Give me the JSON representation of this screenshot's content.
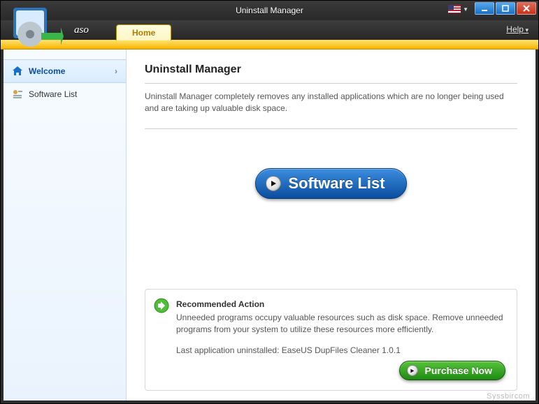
{
  "window": {
    "title": "Uninstall Manager"
  },
  "header": {
    "brand": "aso",
    "home_tab": "Home",
    "help_label": "Help"
  },
  "sidebar": {
    "items": [
      {
        "label": "Welcome"
      },
      {
        "label": "Software List"
      }
    ]
  },
  "main": {
    "title": "Uninstall Manager",
    "description": "Uninstall Manager completely removes any installed applications which are no longer being used and are taking up valuable disk space.",
    "big_button_label": "Software List"
  },
  "recommended": {
    "title": "Recommended Action",
    "description": "Unneeded programs occupy valuable resources such as disk space. Remove unneeded programs from your system to utilize these resources more efficiently.",
    "last_uninstalled_prefix": "Last application uninstalled:  ",
    "last_uninstalled_app": "EaseUS DupFiles Cleaner 1.0.1",
    "purchase_label": "Purchase Now"
  },
  "footer": {
    "watermark": "Syssbircom"
  }
}
